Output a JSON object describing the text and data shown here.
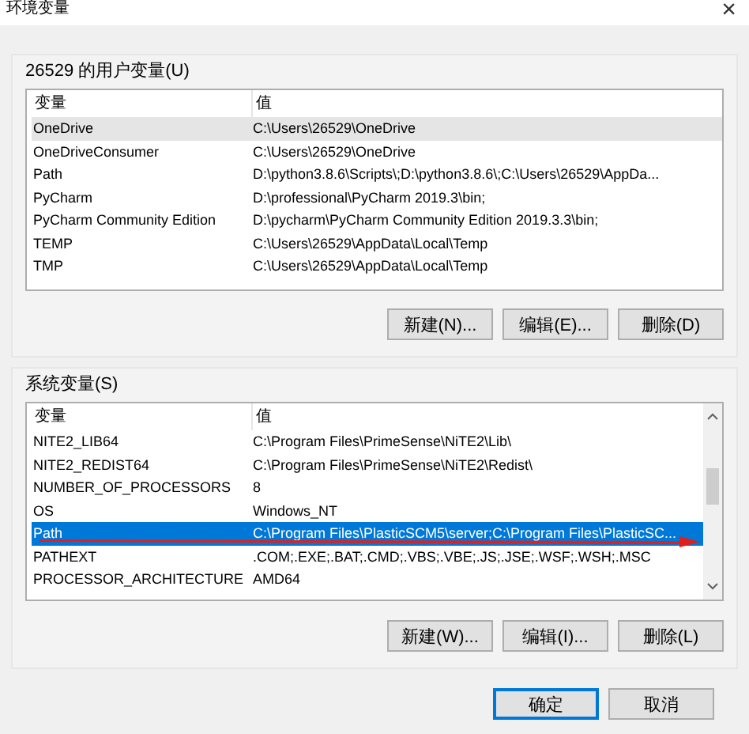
{
  "window": {
    "title": "环境变量",
    "close": "×"
  },
  "user_vars": {
    "label": "26529 的用户变量(U)",
    "focused": false,
    "columns": [
      "变量",
      "值"
    ],
    "rows": [
      {
        "name": "OneDrive",
        "value": "C:\\Users\\26529\\OneDrive",
        "selected": true
      },
      {
        "name": "OneDriveConsumer",
        "value": "C:\\Users\\26529\\OneDrive",
        "selected": false
      },
      {
        "name": "Path",
        "value": "D:\\python3.8.6\\Scripts\\;D:\\python3.8.6\\;C:\\Users\\26529\\AppDa...",
        "selected": false
      },
      {
        "name": "PyCharm",
        "value": "D:\\professional\\PyCharm 2019.3\\bin;",
        "selected": false
      },
      {
        "name": "PyCharm Community Edition",
        "value": "D:\\pycharm\\PyCharm Community Edition 2019.3.3\\bin;",
        "selected": false
      },
      {
        "name": "TEMP",
        "value": "C:\\Users\\26529\\AppData\\Local\\Temp",
        "selected": false
      },
      {
        "name": "TMP",
        "value": "C:\\Users\\26529\\AppData\\Local\\Temp",
        "selected": false
      }
    ],
    "buttons": [
      "新建(N)...",
      "编辑(E)...",
      "删除(D)"
    ]
  },
  "system_vars": {
    "label": "系统变量(S)",
    "focused": true,
    "columns": [
      "变量",
      "值"
    ],
    "rows": [
      {
        "name": "NITE2_LIB64",
        "value": "C:\\Program Files\\PrimeSense\\NiTE2\\Lib\\",
        "selected": false
      },
      {
        "name": "NITE2_REDIST64",
        "value": "C:\\Program Files\\PrimeSense\\NiTE2\\Redist\\",
        "selected": false
      },
      {
        "name": "NUMBER_OF_PROCESSORS",
        "value": "8",
        "selected": false
      },
      {
        "name": "OS",
        "value": "Windows_NT",
        "selected": false
      },
      {
        "name": "Path",
        "value": "C:\\Program Files\\PlasticSCM5\\server;C:\\Program Files\\PlasticSC...",
        "selected": true
      },
      {
        "name": "PATHEXT",
        "value": ".COM;.EXE;.BAT;.CMD;.VBS;.VBE;.JS;.JSE;.WSF;.WSH;.MSC",
        "selected": false
      },
      {
        "name": "PROCESSOR_ARCHITECTURE",
        "value": "AMD64",
        "selected": false
      }
    ],
    "buttons": [
      "新建(W)...",
      "编辑(I)...",
      "删除(L)"
    ]
  },
  "footer_buttons": [
    {
      "label": "确定",
      "default": true
    },
    {
      "label": "取消",
      "default": false
    }
  ]
}
